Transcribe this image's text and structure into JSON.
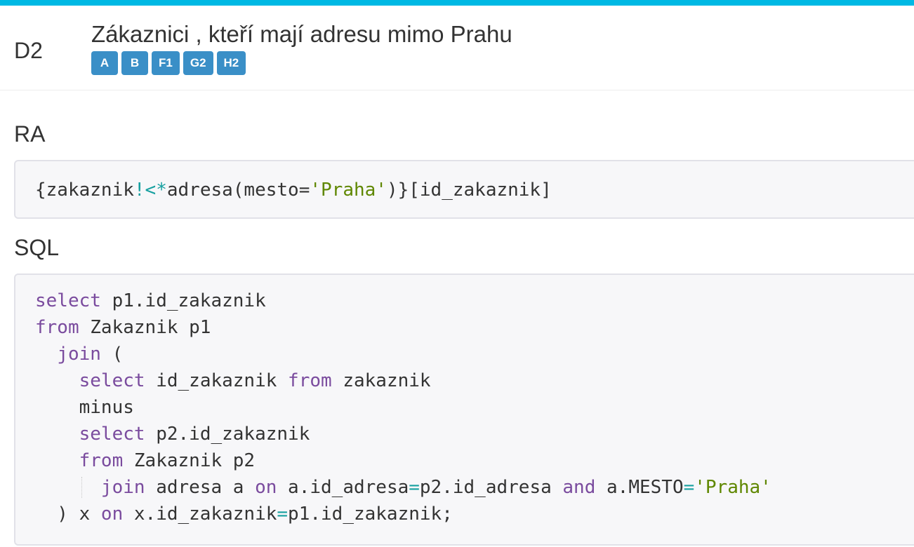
{
  "header": {
    "task_id": "D2",
    "title": "Zákaznici , kteří mají adresu mimo Prahu",
    "tags": [
      "A",
      "B",
      "F1",
      "G2",
      "H2"
    ]
  },
  "ra": {
    "label": "RA",
    "code": {
      "part1": "{zakaznik",
      "op1": "!<*",
      "part2": "adresa(mesto=",
      "str1": "'Praha'",
      "part3": ")}[id_zakaznik]"
    }
  },
  "sql": {
    "label": "SQL",
    "lines": {
      "l1_kw": "select",
      "l1_rest": " p1.id_zakaznik",
      "l2_kw": "from",
      "l2_rest": " Zakaznik p1",
      "l3_indent": "  ",
      "l3_kw": "join",
      "l3_rest": " (",
      "l4_indent": "    ",
      "l4_kw1": "select",
      "l4_mid": " id_zakaznik ",
      "l4_kw2": "from",
      "l4_rest": " zakaznik",
      "l5": "    minus",
      "l6_indent": "    ",
      "l6_kw": "select",
      "l6_rest": " p2.id_zakaznik",
      "l7_indent": "    ",
      "l7_kw": "from",
      "l7_rest": " Zakaznik p2",
      "l8_indent": "      ",
      "l8_kw1": "join",
      "l8_a": " adresa a ",
      "l8_kw2": "on",
      "l8_b": " a.id_adresa",
      "l8_op1": "=",
      "l8_c": "p2.id_adresa ",
      "l8_kw3": "and",
      "l8_d": " a.MESTO",
      "l8_op2": "=",
      "l8_str": "'Praha'",
      "l9_a": "  ) x ",
      "l9_kw": "on",
      "l9_b": " x.id_zakaznik",
      "l9_op": "=",
      "l9_c": "p1.id_zakaznik;"
    }
  }
}
